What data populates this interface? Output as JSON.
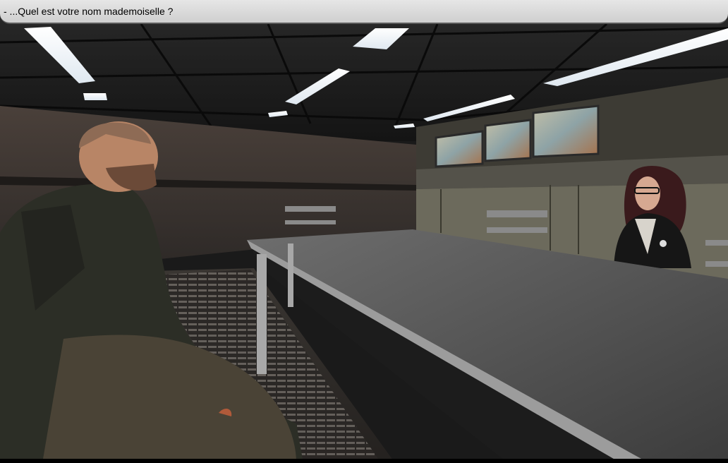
{
  "dialog": {
    "text": "- ...Quel est votre nom mademoiselle ?"
  },
  "scene": {
    "characters": [
      "bald-bearded-man",
      "woman-with-glasses"
    ]
  },
  "colors": {
    "dialog_bg": "#d9d9d9",
    "dialog_border": "#5a5a5a"
  }
}
